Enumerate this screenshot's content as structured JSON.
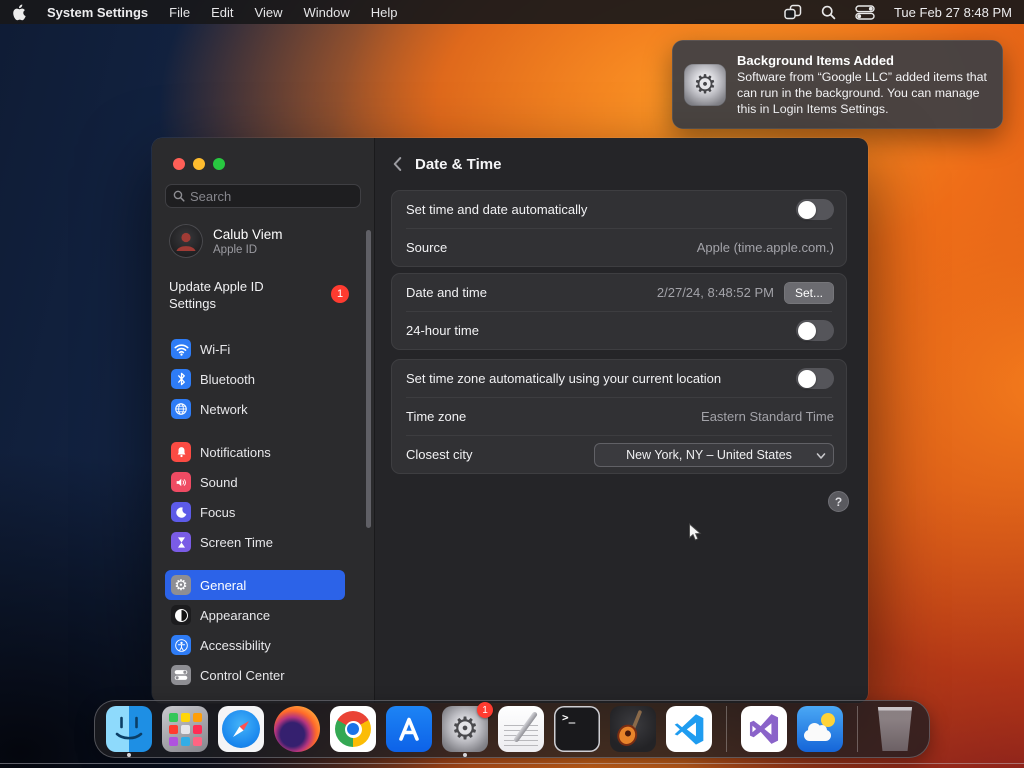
{
  "colors": {
    "accent": "#2c63e8",
    "badge": "#ff3b30",
    "traffic-red": "#ff5f57",
    "traffic-yellow": "#febc2e",
    "traffic-green": "#28c840",
    "tile-blue": "#2e7cf6",
    "tile-red": "#fb4b43",
    "tile-pink": "#ef4b63",
    "tile-indigo": "#5d5be8",
    "tile-purple": "#7a5ce6",
    "tile-gray": "#8e8e93"
  },
  "menu_bar": {
    "app_name": "System Settings",
    "menus": [
      "File",
      "Edit",
      "View",
      "Window",
      "Help"
    ],
    "status_icons": [
      "stage-manager-icon",
      "spotlight-icon",
      "control-center-icon"
    ],
    "clock": "Tue Feb 27  8:48 PM"
  },
  "notification": {
    "title": "Background Items Added",
    "body": "Software from “Google LLC” added items that can run in the background. You can manage this in Login Items Settings."
  },
  "window": {
    "sidebar": {
      "search_placeholder": "Search",
      "profile": {
        "name": "Calub Viem",
        "subtitle": "Apple ID"
      },
      "update": {
        "label": "Update Apple ID Settings",
        "badge": "1"
      },
      "nav": [
        {
          "label": "Wi-Fi",
          "icon": "wifi-icon"
        },
        {
          "label": "Bluetooth",
          "icon": "bluetooth-icon"
        },
        {
          "label": "Network",
          "icon": "globe-icon"
        },
        {
          "label": "Notifications",
          "icon": "bell-icon"
        },
        {
          "label": "Sound",
          "icon": "speaker-icon"
        },
        {
          "label": "Focus",
          "icon": "moon-icon"
        },
        {
          "label": "Screen Time",
          "icon": "hourglass-icon"
        },
        {
          "label": "General",
          "icon": "gear-icon",
          "selected": true
        },
        {
          "label": "Appearance",
          "icon": "appearance-icon"
        },
        {
          "label": "Accessibility",
          "icon": "accessibility-icon"
        },
        {
          "label": "Control Center",
          "icon": "control-center-icon"
        }
      ]
    },
    "content": {
      "title": "Date & Time",
      "groups": [
        {
          "rows": [
            {
              "label": "Set time and date automatically",
              "control": "toggle",
              "state": "off"
            },
            {
              "label": "Source",
              "value": "Apple (time.apple.com.)"
            }
          ]
        },
        {
          "rows": [
            {
              "label": "Date and time",
              "value": "2/27/24, 8:48:52 PM",
              "button": "Set..."
            },
            {
              "label": "24-hour time",
              "control": "toggle",
              "state": "off"
            }
          ]
        },
        {
          "rows": [
            {
              "label": "Set time zone automatically using your current location",
              "control": "toggle",
              "state": "off"
            },
            {
              "label": "Time zone",
              "value": "Eastern Standard Time"
            },
            {
              "label": "Closest city",
              "select": "New York, NY – United States"
            }
          ]
        }
      ],
      "help_label": "?"
    }
  },
  "dock": {
    "items": [
      {
        "name": "Finder",
        "running": true
      },
      {
        "name": "Launchpad"
      },
      {
        "name": "Safari"
      },
      {
        "name": "Firefox"
      },
      {
        "name": "Google Chrome"
      },
      {
        "name": "App Store"
      },
      {
        "name": "System Settings",
        "badge": "1",
        "running": true
      },
      {
        "name": "TextEdit"
      },
      {
        "name": "Terminal",
        "glyph": ">_"
      },
      {
        "name": "GarageBand"
      },
      {
        "name": "VS Code"
      },
      {
        "name": "Visual Studio"
      },
      {
        "name": "Weather"
      },
      {
        "name": "Trash"
      }
    ]
  }
}
